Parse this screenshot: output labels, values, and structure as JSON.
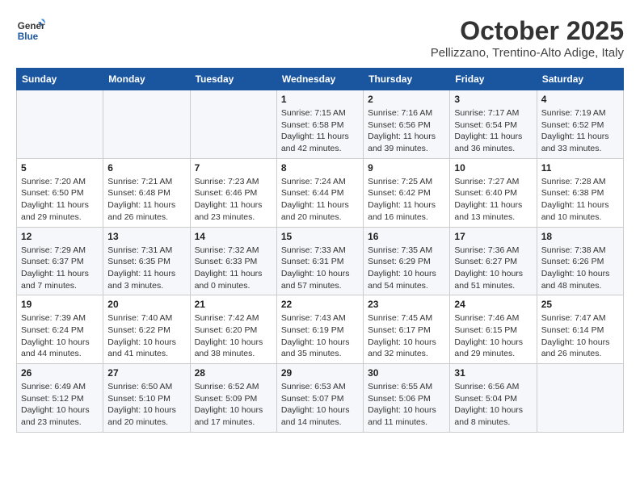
{
  "header": {
    "logo_line1": "General",
    "logo_line2": "Blue",
    "month_title": "October 2025",
    "location": "Pellizzano, Trentino-Alto Adige, Italy"
  },
  "days_of_week": [
    "Sunday",
    "Monday",
    "Tuesday",
    "Wednesday",
    "Thursday",
    "Friday",
    "Saturday"
  ],
  "weeks": [
    [
      {
        "day": "",
        "info": ""
      },
      {
        "day": "",
        "info": ""
      },
      {
        "day": "",
        "info": ""
      },
      {
        "day": "1",
        "info": "Sunrise: 7:15 AM\nSunset: 6:58 PM\nDaylight: 11 hours and 42 minutes."
      },
      {
        "day": "2",
        "info": "Sunrise: 7:16 AM\nSunset: 6:56 PM\nDaylight: 11 hours and 39 minutes."
      },
      {
        "day": "3",
        "info": "Sunrise: 7:17 AM\nSunset: 6:54 PM\nDaylight: 11 hours and 36 minutes."
      },
      {
        "day": "4",
        "info": "Sunrise: 7:19 AM\nSunset: 6:52 PM\nDaylight: 11 hours and 33 minutes."
      }
    ],
    [
      {
        "day": "5",
        "info": "Sunrise: 7:20 AM\nSunset: 6:50 PM\nDaylight: 11 hours and 29 minutes."
      },
      {
        "day": "6",
        "info": "Sunrise: 7:21 AM\nSunset: 6:48 PM\nDaylight: 11 hours and 26 minutes."
      },
      {
        "day": "7",
        "info": "Sunrise: 7:23 AM\nSunset: 6:46 PM\nDaylight: 11 hours and 23 minutes."
      },
      {
        "day": "8",
        "info": "Sunrise: 7:24 AM\nSunset: 6:44 PM\nDaylight: 11 hours and 20 minutes."
      },
      {
        "day": "9",
        "info": "Sunrise: 7:25 AM\nSunset: 6:42 PM\nDaylight: 11 hours and 16 minutes."
      },
      {
        "day": "10",
        "info": "Sunrise: 7:27 AM\nSunset: 6:40 PM\nDaylight: 11 hours and 13 minutes."
      },
      {
        "day": "11",
        "info": "Sunrise: 7:28 AM\nSunset: 6:38 PM\nDaylight: 11 hours and 10 minutes."
      }
    ],
    [
      {
        "day": "12",
        "info": "Sunrise: 7:29 AM\nSunset: 6:37 PM\nDaylight: 11 hours and 7 minutes."
      },
      {
        "day": "13",
        "info": "Sunrise: 7:31 AM\nSunset: 6:35 PM\nDaylight: 11 hours and 3 minutes."
      },
      {
        "day": "14",
        "info": "Sunrise: 7:32 AM\nSunset: 6:33 PM\nDaylight: 11 hours and 0 minutes."
      },
      {
        "day": "15",
        "info": "Sunrise: 7:33 AM\nSunset: 6:31 PM\nDaylight: 10 hours and 57 minutes."
      },
      {
        "day": "16",
        "info": "Sunrise: 7:35 AM\nSunset: 6:29 PM\nDaylight: 10 hours and 54 minutes."
      },
      {
        "day": "17",
        "info": "Sunrise: 7:36 AM\nSunset: 6:27 PM\nDaylight: 10 hours and 51 minutes."
      },
      {
        "day": "18",
        "info": "Sunrise: 7:38 AM\nSunset: 6:26 PM\nDaylight: 10 hours and 48 minutes."
      }
    ],
    [
      {
        "day": "19",
        "info": "Sunrise: 7:39 AM\nSunset: 6:24 PM\nDaylight: 10 hours and 44 minutes."
      },
      {
        "day": "20",
        "info": "Sunrise: 7:40 AM\nSunset: 6:22 PM\nDaylight: 10 hours and 41 minutes."
      },
      {
        "day": "21",
        "info": "Sunrise: 7:42 AM\nSunset: 6:20 PM\nDaylight: 10 hours and 38 minutes."
      },
      {
        "day": "22",
        "info": "Sunrise: 7:43 AM\nSunset: 6:19 PM\nDaylight: 10 hours and 35 minutes."
      },
      {
        "day": "23",
        "info": "Sunrise: 7:45 AM\nSunset: 6:17 PM\nDaylight: 10 hours and 32 minutes."
      },
      {
        "day": "24",
        "info": "Sunrise: 7:46 AM\nSunset: 6:15 PM\nDaylight: 10 hours and 29 minutes."
      },
      {
        "day": "25",
        "info": "Sunrise: 7:47 AM\nSunset: 6:14 PM\nDaylight: 10 hours and 26 minutes."
      }
    ],
    [
      {
        "day": "26",
        "info": "Sunrise: 6:49 AM\nSunset: 5:12 PM\nDaylight: 10 hours and 23 minutes."
      },
      {
        "day": "27",
        "info": "Sunrise: 6:50 AM\nSunset: 5:10 PM\nDaylight: 10 hours and 20 minutes."
      },
      {
        "day": "28",
        "info": "Sunrise: 6:52 AM\nSunset: 5:09 PM\nDaylight: 10 hours and 17 minutes."
      },
      {
        "day": "29",
        "info": "Sunrise: 6:53 AM\nSunset: 5:07 PM\nDaylight: 10 hours and 14 minutes."
      },
      {
        "day": "30",
        "info": "Sunrise: 6:55 AM\nSunset: 5:06 PM\nDaylight: 10 hours and 11 minutes."
      },
      {
        "day": "31",
        "info": "Sunrise: 6:56 AM\nSunset: 5:04 PM\nDaylight: 10 hours and 8 minutes."
      },
      {
        "day": "",
        "info": ""
      }
    ]
  ]
}
